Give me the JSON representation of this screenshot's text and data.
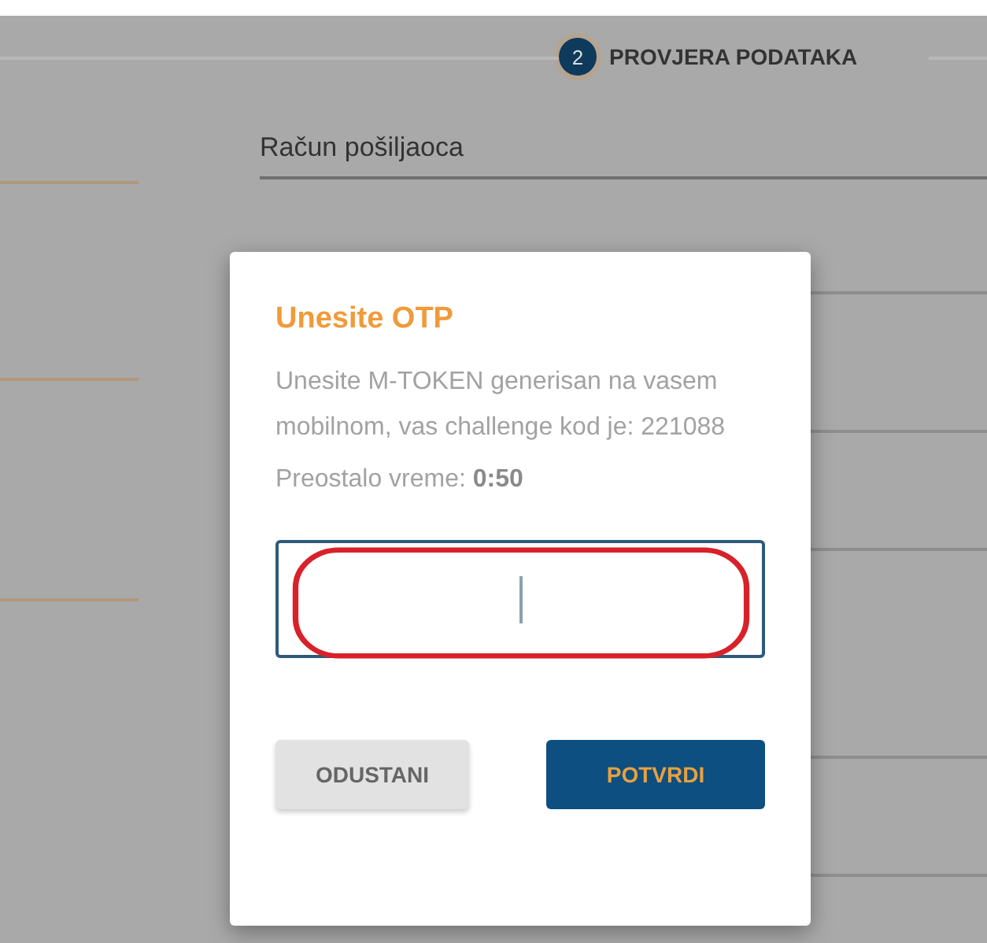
{
  "stepper": {
    "number": "2",
    "label": "PROVJERA PODATAKA",
    "selected": true
  },
  "form_fields": [
    {
      "label": "Račun pošiljaoca"
    }
  ],
  "dialog": {
    "title": "Unesite OTP",
    "message": "Unesite M-TOKEN generisan na vasem mobilnom, vas challenge kod je: 221088",
    "timer": "Preostalo vreme: **0:50**",
    "input": {
      "focused": true
    },
    "buttons": [
      {
        "label": "ODUSTANI",
        "kind": "secondary"
      },
      {
        "label": "POTVRDI",
        "kind": "primary"
      }
    ]
  }
}
